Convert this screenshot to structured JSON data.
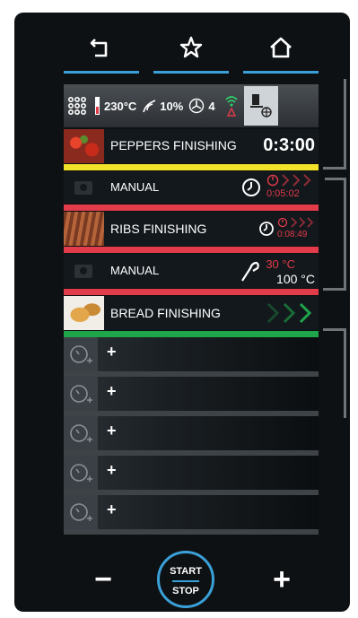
{
  "nav": {
    "back_icon": "back-arrow-icon",
    "favorite_icon": "star-icon",
    "home_icon": "home-icon"
  },
  "status": {
    "temperature": "230°C",
    "humidity": "10%",
    "fan": "4"
  },
  "programs": [
    {
      "name": "PEPPERS FINISHING",
      "time": "0:3:00",
      "bar_color": "#f2e22a"
    },
    {
      "name": "MANUAL",
      "time": "0:05:02",
      "bar_color": "#e23b4a"
    },
    {
      "name": "RIBS FINISHING",
      "time": "0:08:49",
      "bar_color": "#e23b4a"
    },
    {
      "name": "MANUAL",
      "probe_current": "30 °C",
      "probe_target": "100 °C",
      "bar_color": "#e23b4a"
    },
    {
      "name": "BREAD FINISHING",
      "bar_color": "#1fa54a"
    }
  ],
  "slots": [
    "+",
    "+",
    "+",
    "+",
    "+"
  ],
  "controls": {
    "minus": "−",
    "plus": "+",
    "start": "START",
    "stop": "STOP"
  },
  "colors": {
    "accent": "#3aa0d8",
    "yellow": "#f2e22a",
    "red": "#e23b4a",
    "green": "#1fa54a"
  }
}
